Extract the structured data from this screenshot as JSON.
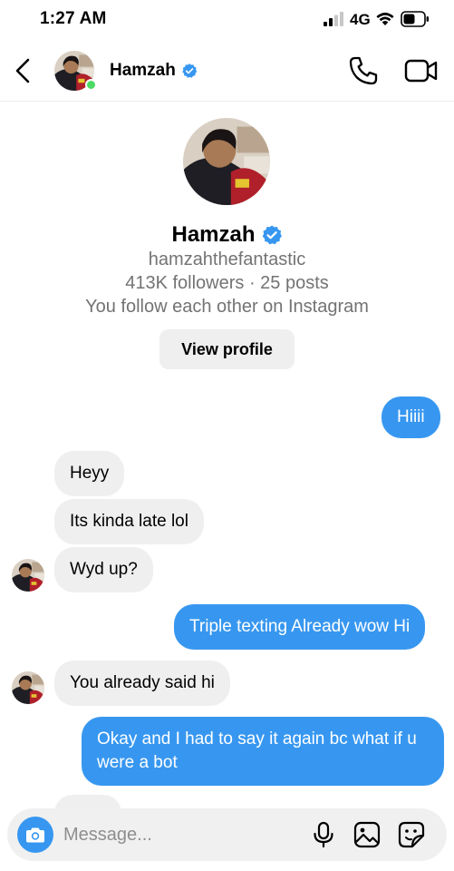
{
  "status_bar": {
    "time": "1:27 AM",
    "network": "4G",
    "icons": [
      "signal-icon",
      "wifi-icon",
      "battery-icon"
    ]
  },
  "header": {
    "contact_name": "Hamzah",
    "verified": true,
    "online": true,
    "icons": [
      "back-chevron-icon",
      "phone-icon",
      "video-camera-icon"
    ]
  },
  "profile": {
    "name": "Hamzah",
    "handle": "hamzahthefantastic",
    "stats": "413K followers · 25 posts",
    "mutual": "You follow each other on Instagram",
    "view_profile_label": "View profile"
  },
  "messages": [
    {
      "from": "me",
      "text": "Hiiii"
    },
    {
      "from": "them",
      "text": "Heyy"
    },
    {
      "from": "them",
      "text": "Its kinda late lol"
    },
    {
      "from": "them",
      "text": "Wyd up?"
    },
    {
      "from": "me",
      "text": "Triple texting Already wow Hi"
    },
    {
      "from": "them",
      "text": "You already said hi"
    },
    {
      "from": "me",
      "text": "Okay and I had to say it again bc what if u were a bot"
    }
  ],
  "composer": {
    "placeholder": "Message...",
    "value": "",
    "icons": [
      "camera-icon",
      "microphone-icon",
      "gallery-icon",
      "sticker-icon"
    ]
  },
  "colors": {
    "accent_blue": "#3797f0",
    "incoming_bubble": "#efefef",
    "secondary_text": "#737373",
    "online_green": "#4cd964"
  }
}
